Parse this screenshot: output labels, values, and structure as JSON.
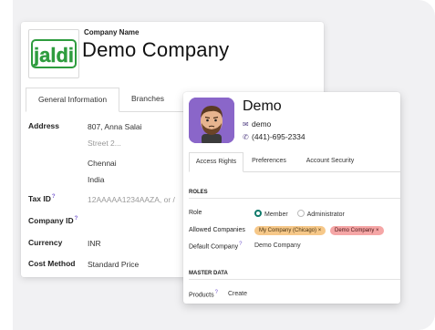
{
  "company": {
    "field_label": "Company Name",
    "name": "Demo Company",
    "logo_text": "jaldi",
    "logo_color": "#2e9c3e",
    "tabs": [
      "General Information",
      "Branches"
    ],
    "address_label": "Address",
    "address_line1": "807, Anna Salai",
    "address_street2_placeholder": "Street 2...",
    "city": "Chennai",
    "country": "India",
    "tax_id_label": "Tax ID",
    "tax_id_placeholder": "12AAAAA1234AAZA, or /",
    "company_id_label": "Company ID",
    "currency_label": "Currency",
    "currency_value": "INR",
    "cost_method_label": "Cost Method",
    "cost_method_value": "Standard Price",
    "help_mark": "?"
  },
  "user": {
    "name": "Demo",
    "login": "demo",
    "phone": "(441)-695-2334",
    "tabs": [
      "Access Rights",
      "Preferences",
      "Account Security"
    ],
    "roles_title": "ROLES",
    "role_label": "Role",
    "role_options": [
      "Member",
      "Administrator"
    ],
    "allowed_companies_label": "Allowed Companies",
    "allowed_companies": [
      {
        "name": "My Company (Chicago)",
        "color": "#f6c889"
      },
      {
        "name": "Demo Company",
        "color": "#f5a6a6"
      }
    ],
    "tag_remove": "×",
    "default_company_label": "Default Company",
    "default_company_value": "Demo Company",
    "master_data_title": "MASTER DATA",
    "products_label": "Products",
    "products_value": "Create",
    "help_mark": "?",
    "accent": "#0f7a6b"
  }
}
